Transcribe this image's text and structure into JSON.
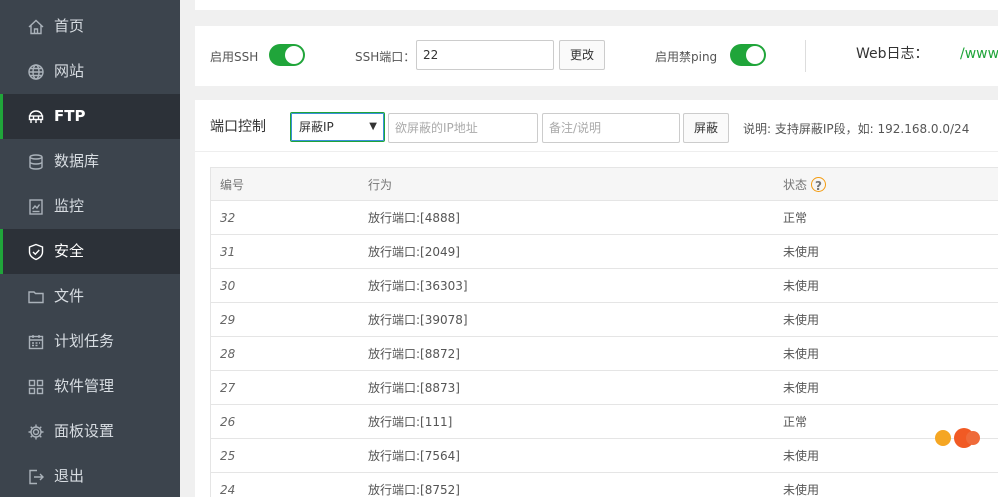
{
  "sidebar": {
    "items": [
      {
        "label": "首页",
        "icon": "home-icon"
      },
      {
        "label": "网站",
        "icon": "globe-icon"
      },
      {
        "label": "FTP",
        "icon": "ftp-icon"
      },
      {
        "label": "数据库",
        "icon": "database-icon"
      },
      {
        "label": "监控",
        "icon": "monitor-icon"
      },
      {
        "label": "安全",
        "icon": "shield-icon"
      },
      {
        "label": "文件",
        "icon": "folder-icon"
      },
      {
        "label": "计划任务",
        "icon": "calendar-icon"
      },
      {
        "label": "软件管理",
        "icon": "apps-icon"
      },
      {
        "label": "面板设置",
        "icon": "gear-icon"
      },
      {
        "label": "退出",
        "icon": "logout-icon"
      }
    ],
    "active": "安全"
  },
  "ssh": {
    "enable_label": "启用SSH",
    "enabled": true,
    "port_label": "SSH端口：",
    "port_value": "22",
    "change_button": "更改",
    "ping_label": "启用禁ping",
    "ping_enabled": true,
    "weblog_label": "Web日志：",
    "weblog_value": "/www"
  },
  "firewall": {
    "title": "端口控制",
    "select_value": "屏蔽IP",
    "ip_placeholder": "欲屏蔽的IP地址",
    "note_placeholder": "备注/说明",
    "submit_button": "屏蔽",
    "hint": "说明: 支持屏蔽IP段，如: 192.168.0.0/24"
  },
  "table": {
    "headers": {
      "id": "编号",
      "action": "行为",
      "status": "状态"
    },
    "help_glyph": "?",
    "rows": [
      {
        "id": "32",
        "action": "放行端口:[4888]",
        "status": "正常"
      },
      {
        "id": "31",
        "action": "放行端口:[2049]",
        "status": "未使用"
      },
      {
        "id": "30",
        "action": "放行端口:[36303]",
        "status": "未使用"
      },
      {
        "id": "29",
        "action": "放行端口:[39078]",
        "status": "未使用"
      },
      {
        "id": "28",
        "action": "放行端口:[8872]",
        "status": "未使用"
      },
      {
        "id": "27",
        "action": "放行端口:[8873]",
        "status": "未使用"
      },
      {
        "id": "26",
        "action": "放行端口:[111]",
        "status": "正常"
      },
      {
        "id": "25",
        "action": "放行端口:[7564]",
        "status": "未使用"
      },
      {
        "id": "24",
        "action": "放行端口:[8752]",
        "status": "未使用"
      }
    ]
  },
  "colors": {
    "sidebar_bg": "#3c444d",
    "active_bg": "#2c3138",
    "accent_green": "#20a53a",
    "help_orange": "#f39c12"
  }
}
